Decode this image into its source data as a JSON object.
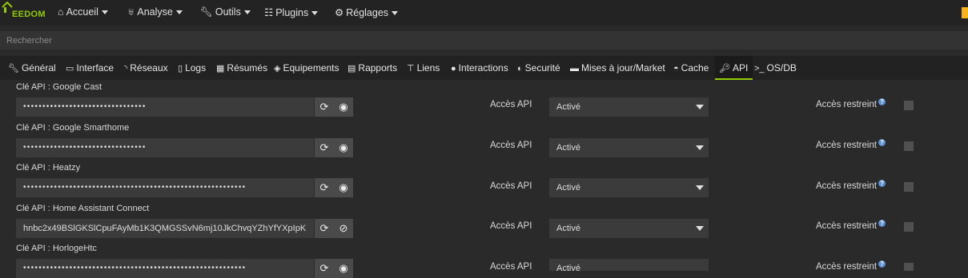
{
  "navbar": {
    "brand": "EEDOM",
    "items": [
      {
        "icon": "home-icon",
        "glyph": "⌂",
        "label": "Accueil"
      },
      {
        "icon": "stethoscope-icon",
        "glyph": "♅",
        "label": "Analyse"
      },
      {
        "icon": "wrench-icon",
        "glyph": "🔧︎",
        "label": "Outils"
      },
      {
        "icon": "list-icon",
        "glyph": "☷",
        "label": "Plugins"
      },
      {
        "icon": "gears-icon",
        "glyph": "⚙",
        "label": "Réglages"
      }
    ]
  },
  "search": {
    "placeholder": "Rechercher"
  },
  "tabs": [
    {
      "icon": "wrench-icon",
      "glyph": "🔧︎",
      "label": "Général"
    },
    {
      "icon": "laptop-icon",
      "glyph": "▭",
      "label": "Interface"
    },
    {
      "icon": "rss-icon",
      "glyph": "◝",
      "label": "Réseaux"
    },
    {
      "icon": "file-icon",
      "glyph": "▯",
      "label": "Logs"
    },
    {
      "icon": "table-icon",
      "glyph": "▦",
      "label": "Résumés"
    },
    {
      "icon": "cube-icon",
      "glyph": "◈",
      "label": "Equipements"
    },
    {
      "icon": "newspaper-icon",
      "glyph": "▤",
      "label": "Rapports"
    },
    {
      "icon": "sitemap-icon",
      "glyph": "⊤",
      "label": "Liens"
    },
    {
      "icon": "microphone-icon",
      "glyph": "●",
      "label": "Interactions"
    },
    {
      "icon": "shield-icon",
      "glyph": "◐",
      "label": "Securité"
    },
    {
      "icon": "credit-card-icon",
      "glyph": "▬",
      "label": "Mises à jour/Market"
    },
    {
      "icon": "car-icon",
      "glyph": "◓",
      "label": "Cache"
    },
    {
      "icon": "key-icon",
      "glyph": "🔑︎",
      "label": "API"
    },
    {
      "icon": "terminal-icon",
      "glyph": ">_",
      "label": "OS/DB"
    }
  ],
  "rows": [
    {
      "label": "Clé API : Google Cast",
      "value": "••••••••••••••••••••••••••••••••",
      "access_label": "Accès API",
      "access_value": "Activé",
      "restricted_label": "Accès restreint",
      "visible": false
    },
    {
      "label": "Clé API : Google Smarthome",
      "value": "••••••••••••••••••••••••••••••••",
      "access_label": "Accès API",
      "access_value": "Activé",
      "restricted_label": "Accès restreint",
      "visible": false
    },
    {
      "label": "Clé API : Heatzy",
      "value": "••••••••••••••••••••••••••••••••••••••••••••••••••••••••••",
      "access_label": "Accès API",
      "access_value": "Activé",
      "restricted_label": "Accès restreint",
      "visible": false
    },
    {
      "label": "Clé API : Home Assistant Connect",
      "value": "hnbc2x49BSlGKSlCpuFAyMb1K3QMGSSvN6mj10JkChvqYZhYfYXpIpK",
      "access_label": "Accès API",
      "access_value": "Activé",
      "restricted_label": "Accès restreint",
      "visible": true
    },
    {
      "label": "Clé API : HorlogeHtc",
      "value": "••••••••••••••••••••••••••••••••••••••••••••••••••••••••••",
      "access_label": "Accès API",
      "access_value": "Activé",
      "restricted_label": "Accès restreint",
      "visible": false
    }
  ],
  "colors": {
    "accent": "#93ca02",
    "background": "#2a2a2a",
    "navbar": "#232323"
  }
}
